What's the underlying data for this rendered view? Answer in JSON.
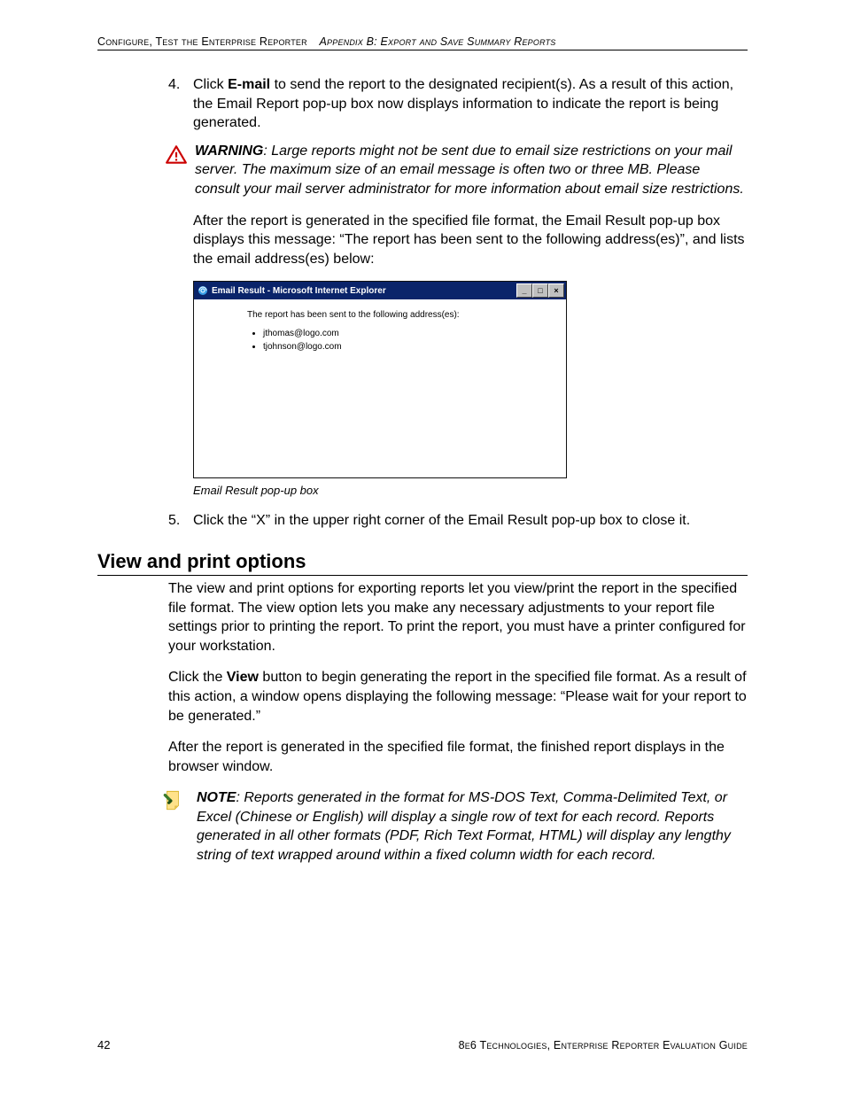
{
  "header": {
    "left": "Configure, Test the Enterprise Reporter",
    "right": "Appendix B: Export and Save Summary Reports"
  },
  "step4": {
    "num": "4.",
    "pre": "Click ",
    "bold": "E-mail",
    "post": " to send the report to the designated recipient(s). As a result of this action, the Email Report pop-up box now displays information to indicate the report is being generated."
  },
  "warning": {
    "label": "WARNING",
    "text": ": Large reports might not be sent due to email size restrictions on your mail server. The maximum size of an email message is often two or three MB. Please consult your mail server administrator for more information about email size restrictions."
  },
  "after_para": "After the report is generated in the specified file format, the Email Result pop-up box displays this message: “The report has been sent to the following address(es)”, and lists the email address(es) below:",
  "screenshot": {
    "title": "Email Result - Microsoft Internet Explorer",
    "msg": "The report has been sent to the following address(es):",
    "emails": [
      "jthomas@logo.com",
      "tjohnson@logo.com"
    ],
    "buttons": {
      "min": "_",
      "max": "□",
      "close": "×"
    }
  },
  "ss_caption": "Email Result pop-up box",
  "step5": {
    "num": "5.",
    "text": "Click the “X” in the upper right corner of the Email Result pop-up box to close it."
  },
  "section_heading": "View and print options",
  "vp_para1": "The view and print options for exporting reports let you view/print the report in the specified file format. The view option lets you make any necessary adjustments to your report file settings prior to printing the report. To print the report, you must have a printer configured for your workstation.",
  "vp_para2_pre": "Click the ",
  "vp_para2_bold": "View",
  "vp_para2_post": " button to begin generating the report in the specified file format. As a result of this action, a window opens displaying the following message: “Please wait for your report to be generated.”",
  "vp_para3": "After the report is generated in the specified file format, the finished report displays in the browser window.",
  "note": {
    "label": "NOTE",
    "text": ": Reports generated in the format for MS-DOS Text, Comma-Delimited Text, or Excel (Chinese or English) will display a single row of text for each record. Reports generated in all other formats (PDF, Rich Text Format, HTML) will display any lengthy string of text wrapped around within a fixed column width for each record."
  },
  "footer": {
    "page": "42",
    "text": "8e6 Technologies, Enterprise Reporter Evaluation Guide"
  }
}
